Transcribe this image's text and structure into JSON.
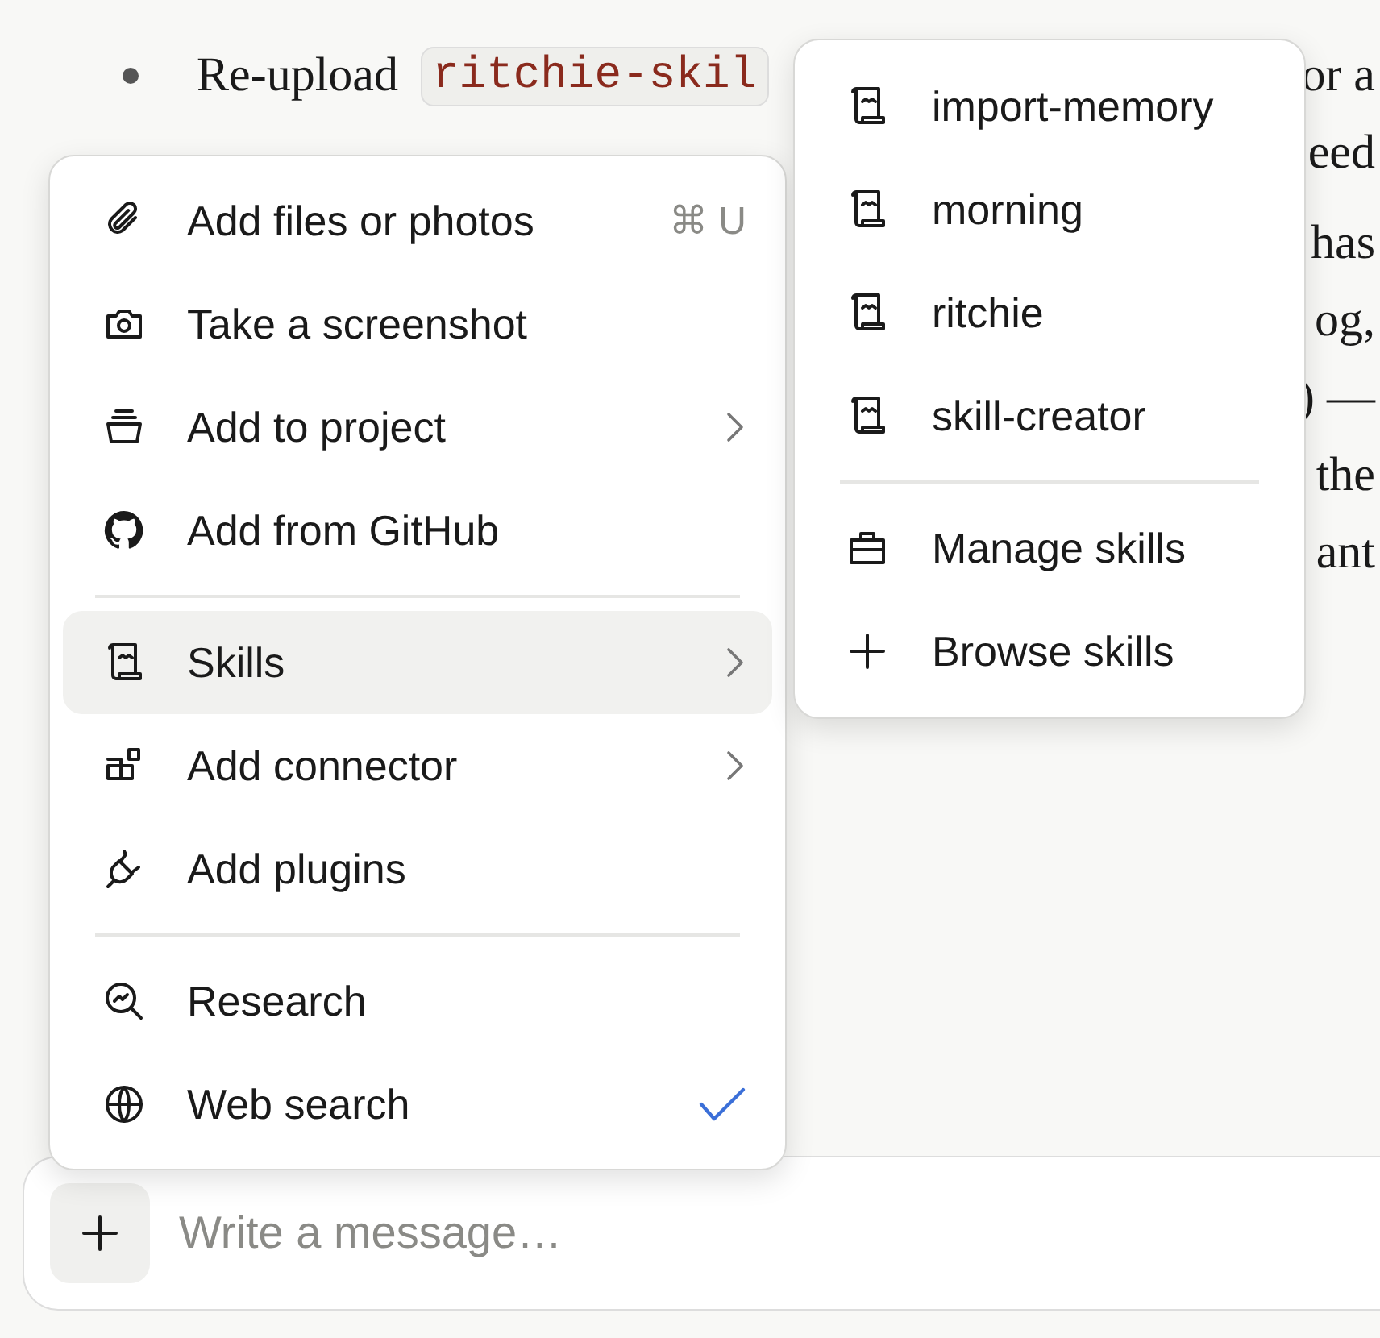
{
  "document": {
    "line_1": {
      "text": "Re-upload",
      "code": "ritchie-skil",
      "tail": "or a"
    },
    "line_2": {
      "tail": "eed"
    },
    "fragments": [
      "has",
      "og,",
      ") —",
      "the",
      "ant"
    ]
  },
  "menu": {
    "items": [
      {
        "kind": "item",
        "label": "Add files or photos",
        "shortcut": "⌘ U",
        "submenu": false,
        "checked": false,
        "selected": false
      },
      {
        "kind": "item",
        "label": "Take a screenshot",
        "submenu": false,
        "checked": false,
        "selected": false
      },
      {
        "kind": "item",
        "label": "Add to project",
        "submenu": true,
        "checked": false,
        "selected": false
      },
      {
        "kind": "item",
        "label": "Add from GitHub",
        "submenu": false,
        "checked": false,
        "selected": false
      },
      {
        "kind": "separator"
      },
      {
        "kind": "item",
        "label": "Skills",
        "submenu": true,
        "checked": false,
        "selected": true
      },
      {
        "kind": "item",
        "label": "Add connector",
        "submenu": true,
        "checked": false,
        "selected": false
      },
      {
        "kind": "item",
        "label": "Add plugins",
        "submenu": false,
        "checked": false,
        "selected": false
      },
      {
        "kind": "separator"
      },
      {
        "kind": "item",
        "label": "Research",
        "submenu": false,
        "checked": false,
        "selected": false
      },
      {
        "kind": "item",
        "label": "Web search",
        "submenu": false,
        "checked": true,
        "selected": false
      }
    ]
  },
  "skills_menu": {
    "items": [
      {
        "kind": "item",
        "label": "import-memory"
      },
      {
        "kind": "item",
        "label": "morning"
      },
      {
        "kind": "item",
        "label": "ritchie"
      },
      {
        "kind": "item",
        "label": "skill-creator"
      },
      {
        "kind": "separator"
      },
      {
        "kind": "item",
        "label": "Manage skills"
      },
      {
        "kind": "item",
        "label": "Browse skills"
      }
    ]
  },
  "composer": {
    "placeholder": "Write a message…"
  }
}
